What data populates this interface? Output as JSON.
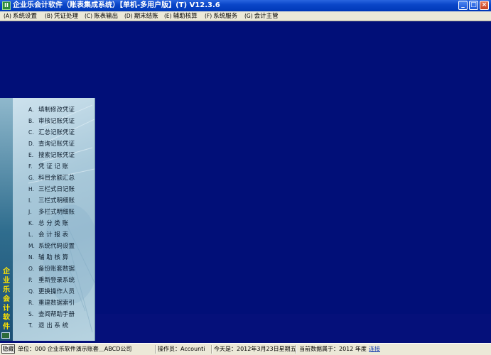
{
  "window": {
    "title": "企业乐会计软件（账表集成系统）【单机-多用户版】(T) V12.3.6",
    "icon_glyph": "II"
  },
  "controls": {
    "minimize": "_",
    "maximize": "□",
    "close": "×"
  },
  "menu": [
    {
      "key": "(A)",
      "label": "系统设置"
    },
    {
      "key": "(B)",
      "label": "凭证处理"
    },
    {
      "key": "(C)",
      "label": "账表输出"
    },
    {
      "key": "(D)",
      "label": "期末结账"
    },
    {
      "key": "(E)",
      "label": "辅助核算"
    },
    {
      "key": "(F)",
      "label": "系统服务"
    },
    {
      "key": "(G)",
      "label": "会计主管"
    }
  ],
  "nav": {
    "vertical_title": "企业乐会计软件",
    "items": [
      {
        "key": "A.",
        "label": "填制修改凭证"
      },
      {
        "key": "B.",
        "label": "审核记账凭证"
      },
      {
        "key": "C.",
        "label": "汇总记账凭证"
      },
      {
        "key": "D.",
        "label": "查询记账凭证"
      },
      {
        "key": "E.",
        "label": "搜索记账凭证"
      },
      {
        "key": "F.",
        "label": "凭 证 记 账"
      },
      {
        "key": "G.",
        "label": "科目余额汇总"
      },
      {
        "key": "H.",
        "label": "三栏式日记账"
      },
      {
        "key": "I.",
        "label": "三栏式明细账"
      },
      {
        "key": "J.",
        "label": "多栏式明细账"
      },
      {
        "key": "K.",
        "label": "总 分 类 账"
      },
      {
        "key": "L.",
        "label": "会 计 报 表"
      },
      {
        "key": "M.",
        "label": "系统代码设置"
      },
      {
        "key": "N.",
        "label": "辅 助 核 算"
      },
      {
        "key": "O.",
        "label": "备份账套数据"
      },
      {
        "key": "P.",
        "label": "重新登录系统"
      },
      {
        "key": "Q.",
        "label": "更换操作人员"
      },
      {
        "key": "R.",
        "label": "重建数据索引"
      },
      {
        "key": "S.",
        "label": "查阅帮助手册"
      },
      {
        "key": "T.",
        "label": "退 出 系 统"
      }
    ]
  },
  "status": {
    "hide_button": "隐藏",
    "unit": "单位：000 企业乐软件演示账套＿ABCD公司",
    "operator": "操作员：Accounti",
    "today": "今天是：2012年3月23日星期五",
    "data_year": "当前数据属于：2012 年度",
    "connect": "连接"
  },
  "colors": {
    "desktop": "#010f78",
    "titlebar": "#0a46c8",
    "menubar": "#ece9d8",
    "nav_title": "#ffe400"
  }
}
